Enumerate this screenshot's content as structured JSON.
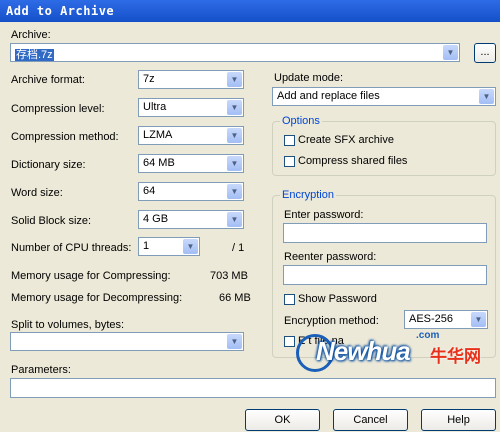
{
  "window": {
    "title": "Add to Archive"
  },
  "archive": {
    "label": "Archive:",
    "value": "存档.7z",
    "browse_label": "..."
  },
  "left": {
    "format": {
      "label": "Archive format:",
      "value": "7z"
    },
    "level": {
      "label": "Compression level:",
      "value": "Ultra"
    },
    "method": {
      "label": "Compression method:",
      "value": "LZMA"
    },
    "dictionary": {
      "label": "Dictionary size:",
      "value": "64 MB"
    },
    "word": {
      "label": "Word size:",
      "value": "64"
    },
    "solid": {
      "label": "Solid Block size:",
      "value": "4 GB"
    },
    "threads": {
      "label": "Number of CPU threads:",
      "value": "1",
      "suffix": "/ 1"
    },
    "mem_compress": {
      "label": "Memory usage for Compressing:",
      "value": "703 MB"
    },
    "mem_decompress": {
      "label": "Memory usage for Decompressing:",
      "value": "66 MB"
    },
    "split": {
      "label": "Split to volumes, bytes:",
      "value": ""
    },
    "parameters": {
      "label": "Parameters:",
      "value": ""
    }
  },
  "right": {
    "update": {
      "label": "Update mode:",
      "value": "Add and replace files"
    },
    "options": {
      "legend": "Options",
      "sfx_label": "Create SFX archive",
      "shared_label": "Compress shared files",
      "sfx_checked": false,
      "shared_checked": false
    },
    "encryption": {
      "legend": "Encryption",
      "enter_label": "Enter password:",
      "reenter_label": "Reenter password:",
      "show_label": "Show Password",
      "show_checked": false,
      "method_label": "Encryption method:",
      "method_value": "AES-256",
      "encrypt_names_partial": "E      t file na"
    }
  },
  "buttons": {
    "ok": "OK",
    "cancel": "Cancel",
    "help": "Help"
  },
  "watermark": {
    "brand": "Newhua",
    "cn": "牛华网",
    "com": ".com"
  },
  "colors": {
    "title_bar": "#1450C8",
    "dialog_bg": "#ECE9D8",
    "group_legend": "#0046D5",
    "selection": "#316AC5"
  }
}
